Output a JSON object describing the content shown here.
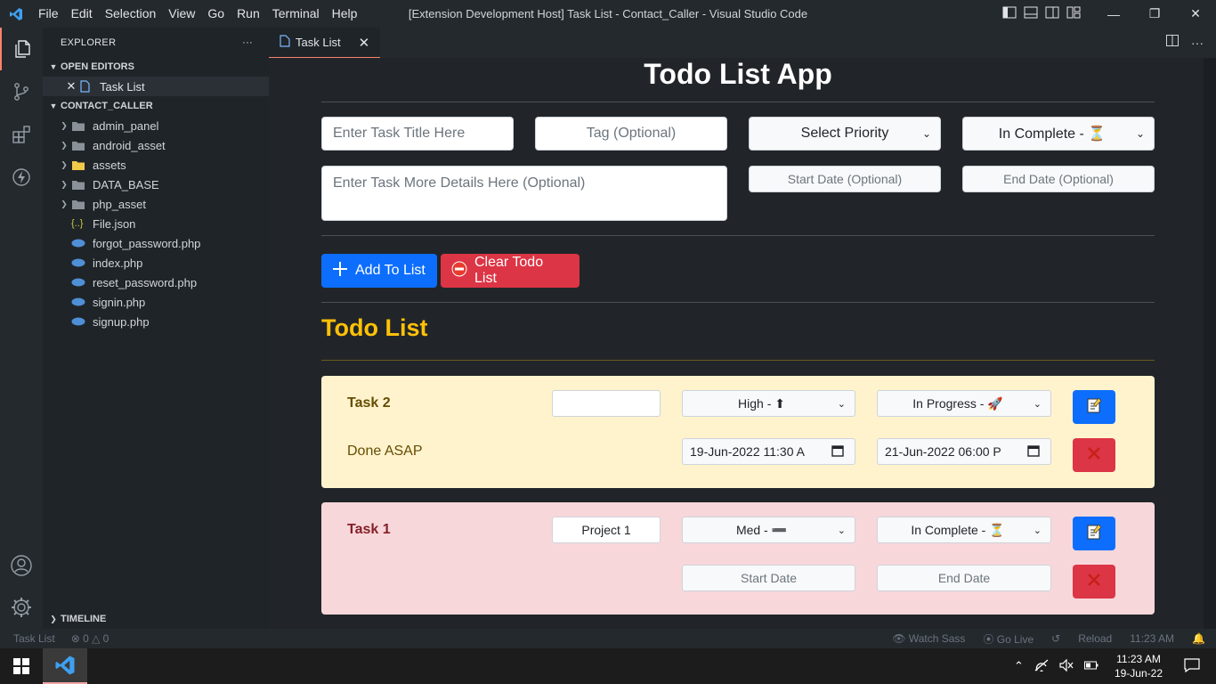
{
  "titlebar": {
    "menu": [
      "File",
      "Edit",
      "Selection",
      "View",
      "Go",
      "Run",
      "Terminal",
      "Help"
    ],
    "window_title": "[Extension Development Host] Task List - Contact_Caller - Visual Studio Code",
    "minimize": "—",
    "restore": "❐",
    "close": "✕"
  },
  "sidebar": {
    "header": "EXPLORER",
    "more": "···",
    "open_editors_label": "OPEN EDITORS",
    "open_editor_item": "Task List",
    "project_label": "CONTACT_CALLER",
    "folders": [
      "admin_panel",
      "android_asset",
      "assets",
      "DATA_BASE",
      "php_asset"
    ],
    "files": [
      "File.json",
      "forgot_password.php",
      "index.php",
      "reset_password.php",
      "signin.php",
      "signup.php"
    ],
    "timeline_label": "TIMELINE"
  },
  "tab": {
    "label": "Task List",
    "close": "✕"
  },
  "app": {
    "title": "Todo List App",
    "task_title_placeholder": "Enter Task Title Here",
    "tag_placeholder": "Tag (Optional)",
    "priority_select": "Select Priority",
    "status_select": "In Complete - ⏳",
    "details_placeholder": "Enter Task More Details Here (Optional)",
    "start_date_placeholder": "Start Date (Optional)",
    "end_date_placeholder": "End Date (Optional)",
    "add_button": "Add To List",
    "clear_button": "Clear Todo List",
    "list_title": "Todo List"
  },
  "tasks": [
    {
      "title": "Task 2",
      "description": "Done ASAP",
      "tag": "",
      "priority": "High - ⬆",
      "status": "In Progress - 🚀",
      "start": "19-Jun-2022 11:30 A",
      "end": "21-Jun-2022 06:00 P",
      "color": "#fff3cd",
      "title_color": "#664d03"
    },
    {
      "title": "Task 1",
      "description": "",
      "tag": "Project 1",
      "priority": "Med - ➖",
      "status": "In Complete - ⏳",
      "start": "Start Date",
      "end": "End Date",
      "color": "#f8d7da",
      "title_color": "#842029"
    }
  ],
  "statusbar": {
    "left_item": "Task List",
    "problems": "⊗ 0 △ 0",
    "watch_sass": "Watch Sass",
    "go_live": "Go Live",
    "reload": "Reload",
    "time": "11:23 AM"
  },
  "taskbar": {
    "time": "11:23 AM",
    "date": "19-Jun-22"
  },
  "colors": {
    "accent": "#f9826c",
    "primary": "#0d6efd",
    "danger": "#dc3545",
    "warning": "#ffc107"
  }
}
